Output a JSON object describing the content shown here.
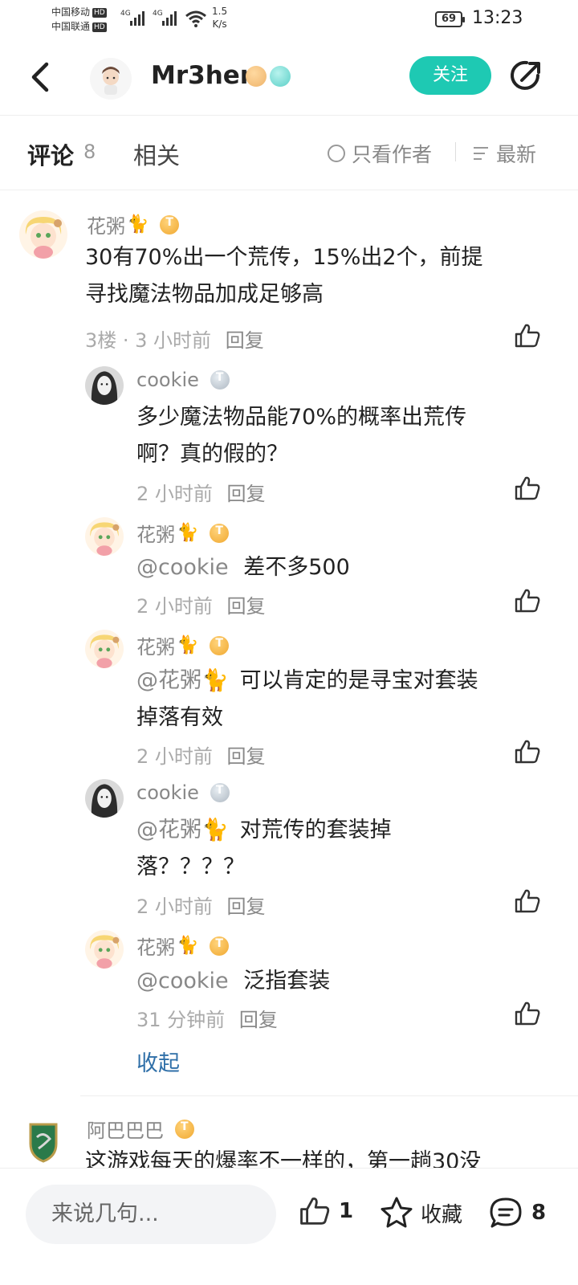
{
  "status_bar": {
    "carrier1": "中国移动",
    "carrier2": "中国联通",
    "hd": "HD",
    "net1": "4G",
    "net2": "4G",
    "speed_value": "1.5",
    "speed_unit": "K/s",
    "battery": "69",
    "time": "13:23"
  },
  "header": {
    "back_icon": "chevron-left-icon",
    "author_name": "Mr3hen",
    "follow_label": "关注",
    "share_icon": "share-icon",
    "accent_color": "#1ec9b3"
  },
  "tabs": {
    "comments_label": "评论",
    "comments_count": "8",
    "related_label": "相关",
    "only_author_label": "只看作者",
    "sort_label": "最新"
  },
  "comments": {
    "main1": {
      "name": "花粥",
      "emoji": "🐈",
      "text_line1": "30有70%出一个荒传，15%出2个，前提",
      "text_line2": "寻找魔法物品加成足够高",
      "meta": "3楼 · 3 小时前",
      "reply": "回复"
    },
    "replies": [
      {
        "name": "cookie",
        "text_line1": "多少魔法物品能70%的概率出荒传",
        "text_line2": "啊？真的假的？",
        "time": "2 小时前",
        "reply": "回复"
      },
      {
        "name": "花粥",
        "emoji": "🐈",
        "mention": "@cookie",
        "text": "差不多500",
        "time": "2 小时前",
        "reply": "回复"
      },
      {
        "name": "花粥",
        "emoji": "🐈",
        "mention": "@花粥🐈",
        "text_line1": "可以肯定的是寻宝对套装",
        "text_line2": "掉落有效",
        "time": "2 小时前",
        "reply": "回复"
      },
      {
        "name": "cookie",
        "mention": "@花粥🐈",
        "text_line1": "对荒传的套装掉",
        "text_line2": "落？？？？",
        "time": "2 小时前",
        "reply": "回复"
      },
      {
        "name": "花粥",
        "emoji": "🐈",
        "mention": "@cookie",
        "text": "泛指套装",
        "time": "31 分钟前",
        "reply": "回复"
      }
    ],
    "collapse_label": "收起",
    "main2": {
      "name": "阿巴巴巴",
      "text_partial": "这游戏每天的爆率不一样的，第一趟30没"
    }
  },
  "bottom_bar": {
    "input_placeholder": "来说几句...",
    "like_count": "1",
    "favorite_label": "收藏",
    "comment_count": "8"
  }
}
